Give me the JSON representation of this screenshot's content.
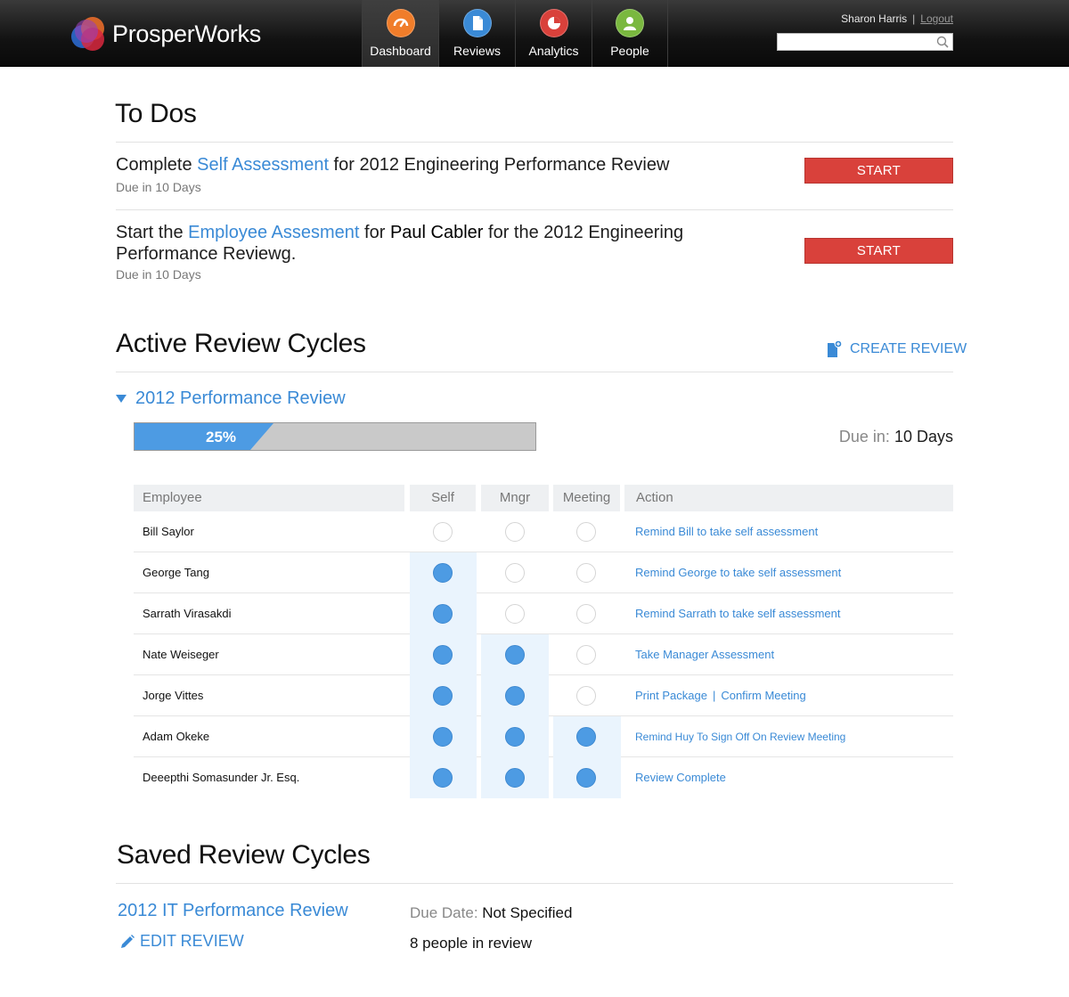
{
  "app": {
    "name": "ProsperWorks"
  },
  "nav": [
    {
      "label": "Dashboard",
      "icon": "gauge-icon",
      "color": "#f07d2a",
      "active": true
    },
    {
      "label": "Reviews",
      "icon": "document-icon",
      "color": "#3a8ad6",
      "active": false
    },
    {
      "label": "Analytics",
      "icon": "pie-chart-icon",
      "color": "#d9413b",
      "active": false
    },
    {
      "label": "People",
      "icon": "person-icon",
      "color": "#7ab83f",
      "active": false
    }
  ],
  "user": {
    "name": "Sharon Harris",
    "separator": "|",
    "logout": "Logout"
  },
  "search": {
    "placeholder": "",
    "value": ""
  },
  "todos": {
    "title": "To Dos",
    "items": [
      {
        "pre": "Complete ",
        "link": "Self Assessment",
        "post": " for 2012 Engineering Performance Review",
        "due": "Due in 10 Days",
        "button": "START"
      },
      {
        "pre": "Start the ",
        "link": "Employee Assesment",
        "mid": " for ",
        "person": "Paul Cabler",
        "post": " for the 2012 Engineering Performance Reviewg.",
        "due": "Due in 10 Days",
        "button": "START"
      }
    ]
  },
  "active": {
    "title": "Active Review Cycles",
    "create": "CREATE REVIEW",
    "cycle": {
      "title": "2012 Performance Review",
      "progress_label": "25%",
      "progress": 0.25,
      "due_label": "Due in:",
      "due_value": "10 Days"
    },
    "columns": [
      "Employee",
      "Self",
      "Mngr",
      "Meeting",
      "Action"
    ],
    "rows": [
      {
        "name": "Bill Saylor",
        "self": false,
        "mngr": false,
        "meeting": false,
        "action": "Remind Bill to take self assessment"
      },
      {
        "name": "George Tang",
        "self": true,
        "mngr": false,
        "meeting": false,
        "action": "Remind George to take self assessment"
      },
      {
        "name": "Sarrath Virasakdi",
        "self": true,
        "mngr": false,
        "meeting": false,
        "action": "Remind Sarrath to take self assessment"
      },
      {
        "name": "Nate Weiseger",
        "self": true,
        "mngr": true,
        "meeting": false,
        "action": "Take Manager Assessment"
      },
      {
        "name": "Jorge Vittes",
        "self": true,
        "mngr": true,
        "meeting": false,
        "action": "Print Package",
        "action2": "Confirm Meeting",
        "pipe": "|"
      },
      {
        "name": "Adam Okeke",
        "self": true,
        "mngr": true,
        "meeting": true,
        "action": "Remind Huy To Sign Off On Review Meeting"
      },
      {
        "name": "Deeepthi Somasunder Jr. Esq.",
        "self": true,
        "mngr": true,
        "meeting": true,
        "action": "Review Complete"
      }
    ]
  },
  "saved": {
    "title": "Saved Review Cycles",
    "cycle_title": "2012 IT Performance Review",
    "edit": "EDIT REVIEW",
    "due_label": "Due Date:",
    "due_value": "Not Specified",
    "people": "8 people in review"
  },
  "colors": {
    "accent": "#3a8ad6",
    "start": "#d9413b",
    "dot": "#4d9be3"
  }
}
